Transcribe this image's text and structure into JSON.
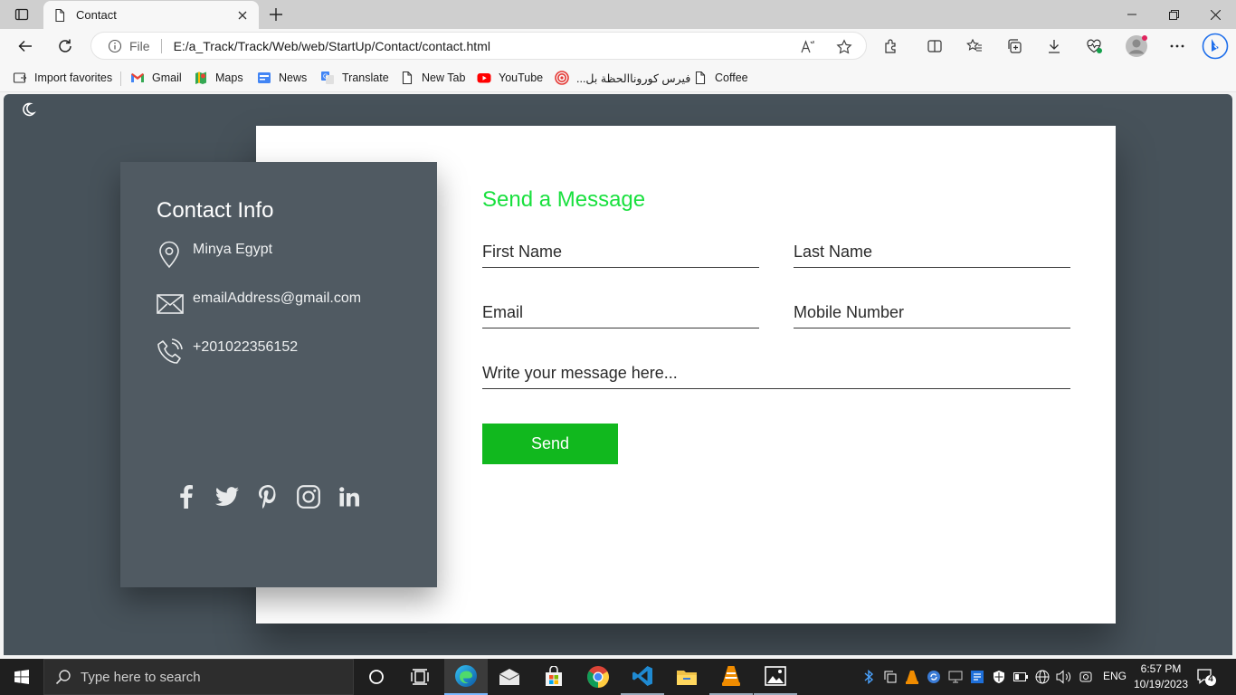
{
  "browser": {
    "tab": {
      "title": "Contact"
    },
    "address": {
      "scheme_label": "File",
      "url": "E:/a_Track/Track/Web/web/StartUp/Contact/contact.html"
    },
    "favorites": [
      {
        "label": "Import favorites",
        "icon": "import-icon"
      },
      {
        "label": "Gmail",
        "icon": "gmail-icon"
      },
      {
        "label": "Maps",
        "icon": "maps-icon"
      },
      {
        "label": "News",
        "icon": "news-icon"
      },
      {
        "label": "Translate",
        "icon": "translate-icon"
      },
      {
        "label": "New Tab",
        "icon": "page-icon"
      },
      {
        "label": "YouTube",
        "icon": "youtube-icon"
      },
      {
        "label": "فيرس كوروناالحظة بل...",
        "icon": "target-icon"
      },
      {
        "label": "Coffee",
        "icon": "page-icon"
      }
    ]
  },
  "page": {
    "contact_info": {
      "title": "Contact Info",
      "location": "Minya Egypt",
      "email": "emailAddress@gmail.com",
      "phone": "+201022356152",
      "socials": [
        "facebook-icon",
        "twitter-icon",
        "pinterest-icon",
        "instagram-icon",
        "linkedin-icon"
      ]
    },
    "form": {
      "title": "Send a Message",
      "first_name_placeholder": "First Name",
      "last_name_placeholder": "Last Name",
      "email_placeholder": "Email",
      "mobile_placeholder": "Mobile Number",
      "message_placeholder": "Write your message here...",
      "send_label": "Send"
    }
  },
  "taskbar": {
    "search_placeholder": "Type here to search",
    "language": "ENG",
    "time": "6:57 PM",
    "date": "10/19/2023",
    "notification_count": "4"
  },
  "colors": {
    "page_background": "#47525a",
    "info_panel": "#505a62",
    "form_title": "#19e03e",
    "send_button": "#11b81e"
  }
}
